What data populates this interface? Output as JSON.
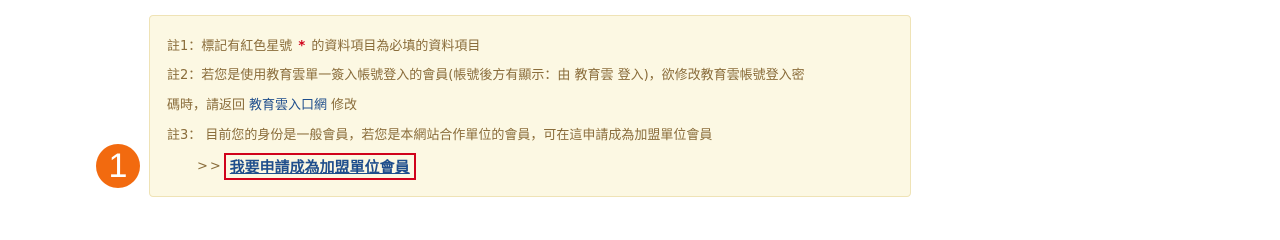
{
  "notes": {
    "note1_prefix": "註1：標記有紅色星號 ",
    "note1_star": "*",
    "note1_suffix": " 的資料項目為必填的資料項目",
    "note2_line1": "註2：若您是使用教育雲單一簽入帳號登入的會員(帳號後方有顯示：由 教育雲 登入)，欲修改教育雲帳號登入密",
    "note2_line2_prefix": "碼時，請返回",
    "note2_link": "教育雲入口網",
    "note2_line2_suffix": "修改",
    "note3": "註3： 目前您的身份是一般會員，若您是本網站合作單位的會員，可在這申請成為加盟單位會員",
    "apply_arrow": ">>",
    "apply_link": "我要申請成為加盟單位會員"
  },
  "badge": {
    "number": "1",
    "color": "#f26a0f"
  },
  "colors": {
    "note_bg": "#fcf8e3",
    "note_text": "#8a6d3b",
    "link": "#1f4e8c",
    "highlight_border": "#d0021b"
  }
}
